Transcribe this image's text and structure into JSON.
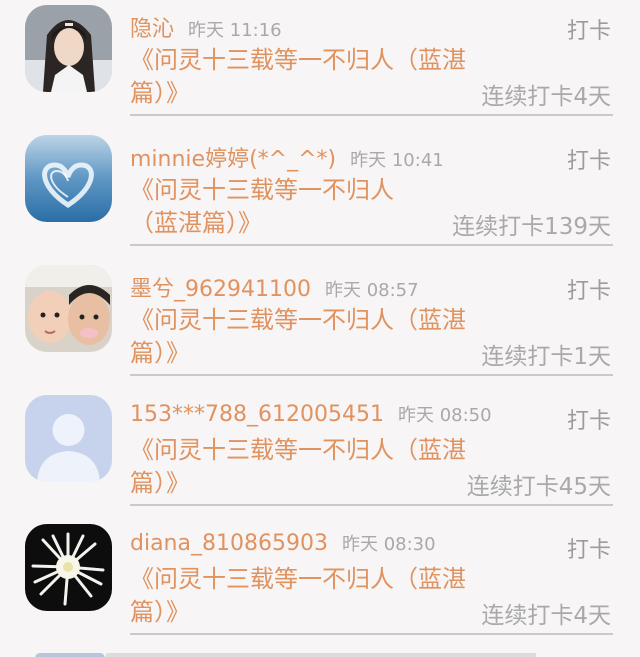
{
  "entries": [
    {
      "name": "隐沁",
      "time": "昨天 11:16",
      "action": "打卡",
      "book": "《问灵十三载等一不归人（蓝湛篇）》",
      "streak": "连续打卡4天",
      "avatar": "avatar-man-long-hair"
    },
    {
      "name": "minnie婷婷(*^_^*)",
      "time": "昨天 10:41",
      "action": "打卡",
      "book": "《问灵十三载等一不归人（蓝湛篇）》",
      "streak": "连续打卡139天",
      "avatar": "avatar-ice-heart"
    },
    {
      "name": "墨兮_962941100",
      "time": "昨天 08:57",
      "action": "打卡",
      "book": "《问灵十三载等一不归人（蓝湛篇）》",
      "streak": "连续打卡1天",
      "avatar": "avatar-two-children"
    },
    {
      "name": "153***788_612005451",
      "time": "昨天 08:50",
      "action": "打卡",
      "book": "《问灵十三载等一不归人（蓝湛篇）》",
      "streak": "连续打卡45天",
      "avatar": "avatar-default-person"
    },
    {
      "name": "diana_810865903",
      "time": "昨天 08:30",
      "action": "打卡",
      "book": "《问灵十三载等一不归人（蓝湛篇）》",
      "streak": "连续打卡4天",
      "avatar": "avatar-white-flower"
    }
  ],
  "colors": {
    "accent": "#e0925f",
    "muted": "#a9a9a9",
    "background": "#f7f5f6",
    "divider": "#c9c9c9"
  }
}
